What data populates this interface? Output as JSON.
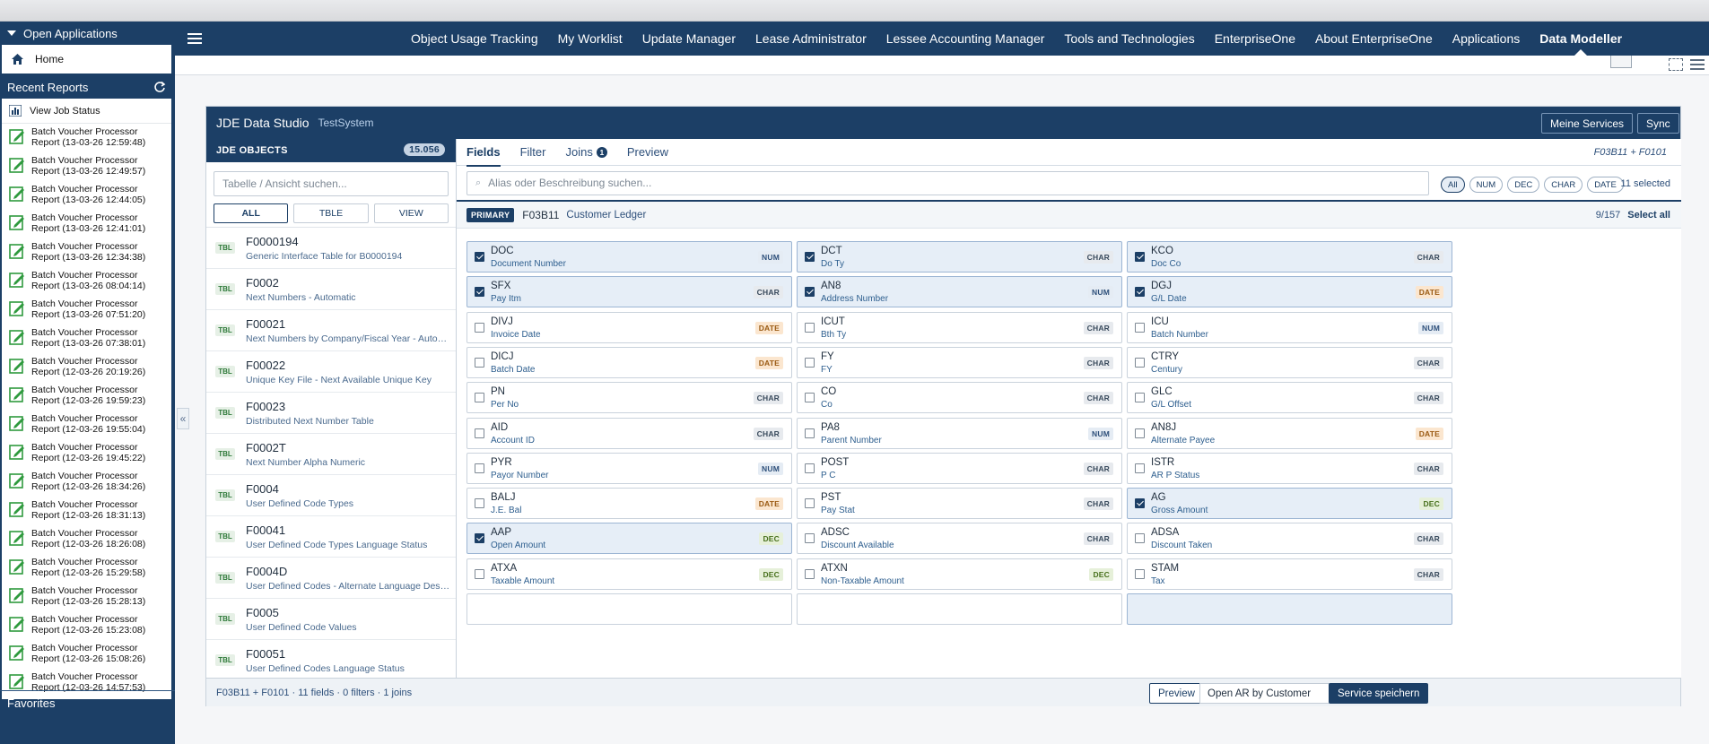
{
  "sidebar": {
    "open_apps_label": "Open Applications",
    "home_label": "Home",
    "recent_reports_label": "Recent Reports",
    "view_job_status_label": "View Job Status",
    "reports": [
      {
        "line1": "Batch Voucher Processor",
        "line2": "Report (13-03-26 12:59:48)"
      },
      {
        "line1": "Batch Voucher Processor",
        "line2": "Report (13-03-26 12:49:57)"
      },
      {
        "line1": "Batch Voucher Processor",
        "line2": "Report (13-03-26 12:44:05)"
      },
      {
        "line1": "Batch Voucher Processor",
        "line2": "Report (13-03-26 12:41:01)"
      },
      {
        "line1": "Batch Voucher Processor",
        "line2": "Report (13-03-26 12:34:38)"
      },
      {
        "line1": "Batch Voucher Processor",
        "line2": "Report (13-03-26 08:04:14)"
      },
      {
        "line1": "Batch Voucher Processor",
        "line2": "Report (13-03-26 07:51:20)"
      },
      {
        "line1": "Batch Voucher Processor",
        "line2": "Report (13-03-26 07:38:01)"
      },
      {
        "line1": "Batch Voucher Processor",
        "line2": "Report (12-03-26 20:19:26)"
      },
      {
        "line1": "Batch Voucher Processor",
        "line2": "Report (12-03-26 19:59:23)"
      },
      {
        "line1": "Batch Voucher Processor",
        "line2": "Report (12-03-26 19:55:04)"
      },
      {
        "line1": "Batch Voucher Processor",
        "line2": "Report (12-03-26 19:45:22)"
      },
      {
        "line1": "Batch Voucher Processor",
        "line2": "Report (12-03-26 18:34:26)"
      },
      {
        "line1": "Batch Voucher Processor",
        "line2": "Report (12-03-26 18:31:13)"
      },
      {
        "line1": "Batch Voucher Processor",
        "line2": "Report (12-03-26 18:26:08)"
      },
      {
        "line1": "Batch Voucher Processor",
        "line2": "Report (12-03-26 15:29:58)"
      },
      {
        "line1": "Batch Voucher Processor",
        "line2": "Report (12-03-26 15:28:13)"
      },
      {
        "line1": "Batch Voucher Processor",
        "line2": "Report (12-03-26 15:23:08)"
      },
      {
        "line1": "Batch Voucher Processor",
        "line2": "Report (12-03-26 15:08:26)"
      },
      {
        "line1": "Batch Voucher Processor",
        "line2": "Report (12-03-26 14:57:53)"
      }
    ],
    "favorites_label": "Favorites"
  },
  "topnav": {
    "links": [
      "Object Usage Tracking",
      "My Worklist",
      "Update Manager",
      "Lease Administrator",
      "Lessee Accounting Manager",
      "Tools and Technologies",
      "EnterpriseOne",
      "About EnterpriseOne",
      "Applications",
      "Data Modeller"
    ],
    "active_index": 9
  },
  "app": {
    "title": "JDE Data Studio",
    "subtitle": "TestSystem",
    "meine_services_label": "Meine Services",
    "sync_label": "Sync"
  },
  "objects": {
    "header": "JDE OBJECTS",
    "count": "15.056",
    "search_placeholder": "Tabelle / Ansicht suchen...",
    "filters": [
      "ALL",
      "TBLE",
      "VIEW"
    ],
    "active_filter": "ALL",
    "tag": "TBL",
    "items": [
      {
        "name": "F0000194",
        "desc": "Generic Interface Table for B0000194"
      },
      {
        "name": "F0002",
        "desc": "Next Numbers - Automatic"
      },
      {
        "name": "F00021",
        "desc": "Next Numbers by Company/Fiscal Year - Autom..."
      },
      {
        "name": "F00022",
        "desc": "Unique Key File - Next Available Unique Key"
      },
      {
        "name": "F00023",
        "desc": "Distributed Next Number Table"
      },
      {
        "name": "F0002T",
        "desc": "Next Number Alpha Numeric"
      },
      {
        "name": "F0004",
        "desc": "User Defined Code Types"
      },
      {
        "name": "F00041",
        "desc": "User Defined Code Types Language Status"
      },
      {
        "name": "F0004D",
        "desc": "User Defined Codes - Alternate Language Descr..."
      },
      {
        "name": "F0005",
        "desc": "User Defined Code Values"
      },
      {
        "name": "F00051",
        "desc": "User Defined Codes Language Status"
      }
    ]
  },
  "fields_panel": {
    "tabs": [
      "Fields",
      "Filter",
      "Joins",
      "Preview"
    ],
    "joins_badge": "1",
    "tables_label": "F03B11 + F0101",
    "search_placeholder": "Alias oder Beschreibung suchen...",
    "type_chips": [
      "All",
      "NUM",
      "DEC",
      "CHAR",
      "DATE"
    ],
    "selected_count": "11 selected",
    "primary_label": "PRIMARY",
    "table_name": "F03B11",
    "table_desc": "Customer Ledger",
    "field_count": "9/157",
    "select_all_label": "Select all",
    "fields": [
      {
        "alias": "DOC",
        "desc": "Document Number",
        "type": "NUM",
        "checked": true
      },
      {
        "alias": "DCT",
        "desc": "Do Ty",
        "type": "CHAR",
        "checked": true
      },
      {
        "alias": "KCO",
        "desc": "Doc Co",
        "type": "CHAR",
        "checked": true
      },
      {
        "alias": "SFX",
        "desc": "Pay Itm",
        "type": "CHAR",
        "checked": true
      },
      {
        "alias": "AN8",
        "desc": "Address Number",
        "type": "NUM",
        "checked": true
      },
      {
        "alias": "DGJ",
        "desc": "G/L Date",
        "type": "DATE",
        "checked": true
      },
      {
        "alias": "DIVJ",
        "desc": "Invoice Date",
        "type": "DATE",
        "checked": false
      },
      {
        "alias": "ICUT",
        "desc": "Bth Ty",
        "type": "CHAR",
        "checked": false
      },
      {
        "alias": "ICU",
        "desc": "Batch Number",
        "type": "NUM",
        "checked": false
      },
      {
        "alias": "DICJ",
        "desc": "Batch Date",
        "type": "DATE",
        "checked": false
      },
      {
        "alias": "FY",
        "desc": "FY",
        "type": "CHAR",
        "checked": false
      },
      {
        "alias": "CTRY",
        "desc": "Century",
        "type": "CHAR",
        "checked": false
      },
      {
        "alias": "PN",
        "desc": "Per No",
        "type": "CHAR",
        "checked": false
      },
      {
        "alias": "CO",
        "desc": "Co",
        "type": "CHAR",
        "checked": false
      },
      {
        "alias": "GLC",
        "desc": "G/L Offset",
        "type": "CHAR",
        "checked": false
      },
      {
        "alias": "AID",
        "desc": "Account ID",
        "type": "CHAR",
        "checked": false
      },
      {
        "alias": "PA8",
        "desc": "Parent Number",
        "type": "NUM",
        "checked": false
      },
      {
        "alias": "AN8J",
        "desc": "Alternate Payee",
        "type": "DATE",
        "checked": false
      },
      {
        "alias": "PYR",
        "desc": "Payor Number",
        "type": "NUM",
        "checked": false
      },
      {
        "alias": "POST",
        "desc": "P C",
        "type": "CHAR",
        "checked": false
      },
      {
        "alias": "ISTR",
        "desc": "AR P Status",
        "type": "CHAR",
        "checked": false
      },
      {
        "alias": "BALJ",
        "desc": "J.E. Bal",
        "type": "DATE",
        "checked": false
      },
      {
        "alias": "PST",
        "desc": "Pay Stat",
        "type": "CHAR",
        "checked": false
      },
      {
        "alias": "AG",
        "desc": "Gross Amount",
        "type": "DEC",
        "checked": true
      },
      {
        "alias": "AAP",
        "desc": "Open Amount",
        "type": "DEC",
        "checked": true
      },
      {
        "alias": "ADSC",
        "desc": "Discount Available",
        "type": "CHAR",
        "checked": false
      },
      {
        "alias": "ADSA",
        "desc": "Discount Taken",
        "type": "CHAR",
        "checked": false
      },
      {
        "alias": "ATXA",
        "desc": "Taxable Amount",
        "type": "DEC",
        "checked": false
      },
      {
        "alias": "ATXN",
        "desc": "Non-Taxable Amount",
        "type": "DEC",
        "checked": false
      },
      {
        "alias": "STAM",
        "desc": "Tax",
        "type": "CHAR",
        "checked": false
      }
    ]
  },
  "footer": {
    "summary": "F03B11 + F0101 · 11 fields · 0 filters · 1 joins",
    "preview_label": "Preview",
    "service_name_value": "Open AR by Customer",
    "save_label": "Service speichern"
  }
}
